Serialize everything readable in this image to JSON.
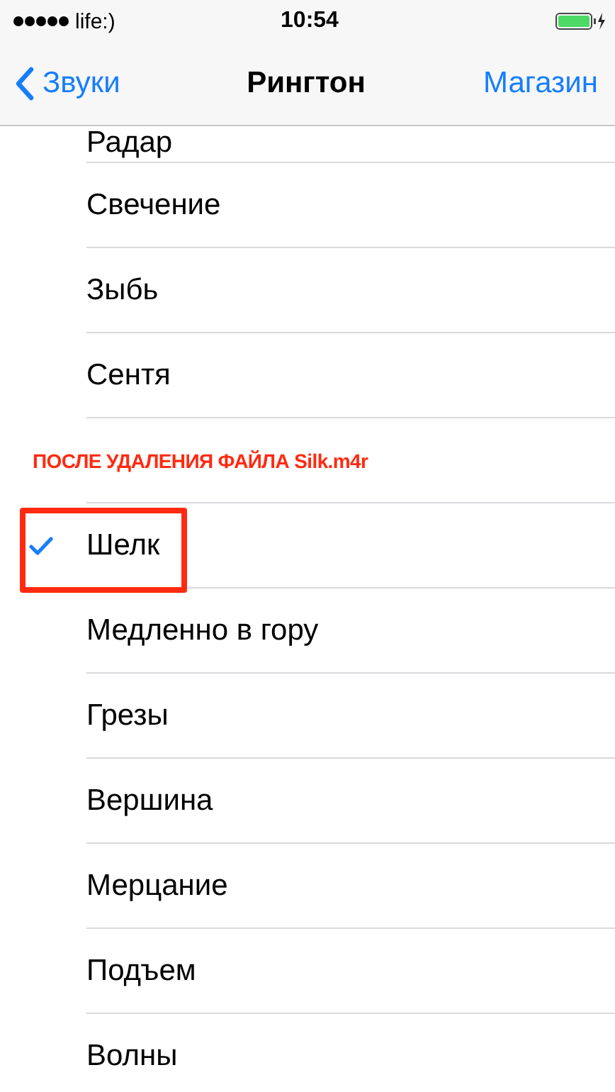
{
  "status_bar": {
    "carrier": "life:)",
    "time": "10:54"
  },
  "nav": {
    "back": "Звуки",
    "title": "Рингтон",
    "action": "Магазин"
  },
  "rows": [
    {
      "label": "Радар",
      "selected": false
    },
    {
      "label": "Свечение",
      "selected": false
    },
    {
      "label": "Зыбь",
      "selected": false
    },
    {
      "label": "Сентя",
      "selected": false
    },
    {
      "selected": false
    },
    {
      "label": "Шелк",
      "selected": true,
      "note": "ПОСЛЕ УДАЛЕНИЯ ФАЙЛА Silk.m4r"
    },
    {
      "label": "Медленно в гору",
      "selected": false
    },
    {
      "label": "Грезы",
      "selected": false
    },
    {
      "label": "Вершина",
      "selected": false
    },
    {
      "label": "Мерцание",
      "selected": false
    },
    {
      "label": "Подъем",
      "selected": false
    },
    {
      "label": "Волны",
      "selected": false
    }
  ]
}
